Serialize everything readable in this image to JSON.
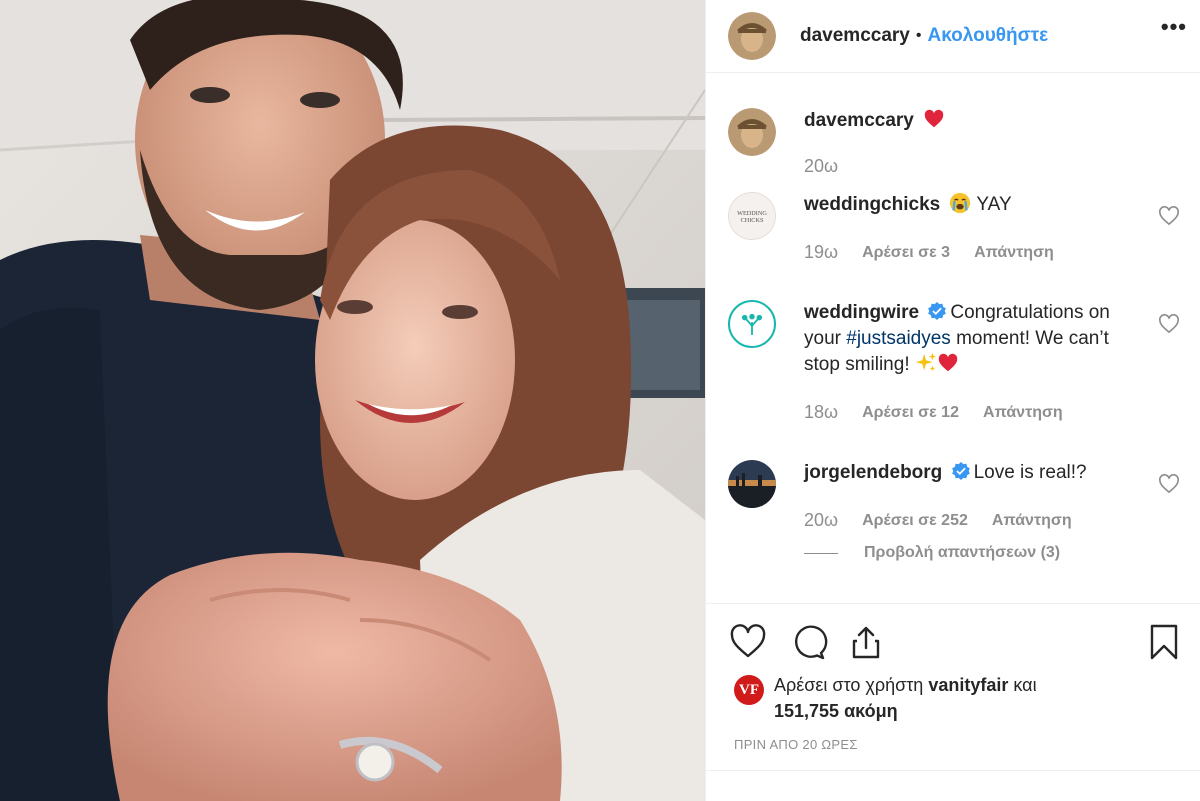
{
  "post": {
    "author": "davemccary",
    "follow_label": "Ακολουθήστε",
    "separator": "•",
    "more_label": "•••"
  },
  "caption": {
    "username": "davemccary",
    "text": "",
    "emoji": "red-heart",
    "time": "20ω"
  },
  "comments": [
    {
      "username": "weddingchicks",
      "verified": false,
      "avatar_text": [
        "WEDDING",
        "CHICKS"
      ],
      "emoji": "loudly-crying-face",
      "text": "YAY",
      "time": "19ω",
      "likes": "Αρέσει σε 3",
      "reply": "Απάντηση"
    },
    {
      "username": "weddingwire",
      "verified": true,
      "text_before": "Congratulations on your ",
      "hashtag": "#justsaidyes",
      "text_after": " moment! We can’t stop smiling!",
      "emojis": [
        "sparkles",
        "red-heart"
      ],
      "time": "18ω",
      "likes": "Αρέσει σε 12",
      "reply": "Απάντηση"
    },
    {
      "username": "jorgelendeborg",
      "verified": true,
      "text": "Love is real!?",
      "time": "20ω",
      "likes": "Αρέσει σε 252",
      "reply": "Απάντηση",
      "view_replies": "Προβολή απαντήσεων (3)"
    }
  ],
  "likes_summary": {
    "avatar_text": "VF",
    "prefix": "Αρέσει στο χρήστη",
    "user": "vanityfair",
    "joiner": "και",
    "count": "151,755 ακόμη"
  },
  "timestamp": "ΠΡΙΝ ΑΠΟ 20 ΩΡΕΣ",
  "colors": {
    "link_blue": "#3897f0",
    "hashtag": "#003569",
    "muted": "#8e8e8e",
    "text": "#262626",
    "heart": "#ed4956"
  },
  "icons": [
    "heart-icon",
    "comment-icon",
    "share-icon",
    "bookmark-icon",
    "more-options-icon",
    "verified-badge-icon"
  ]
}
